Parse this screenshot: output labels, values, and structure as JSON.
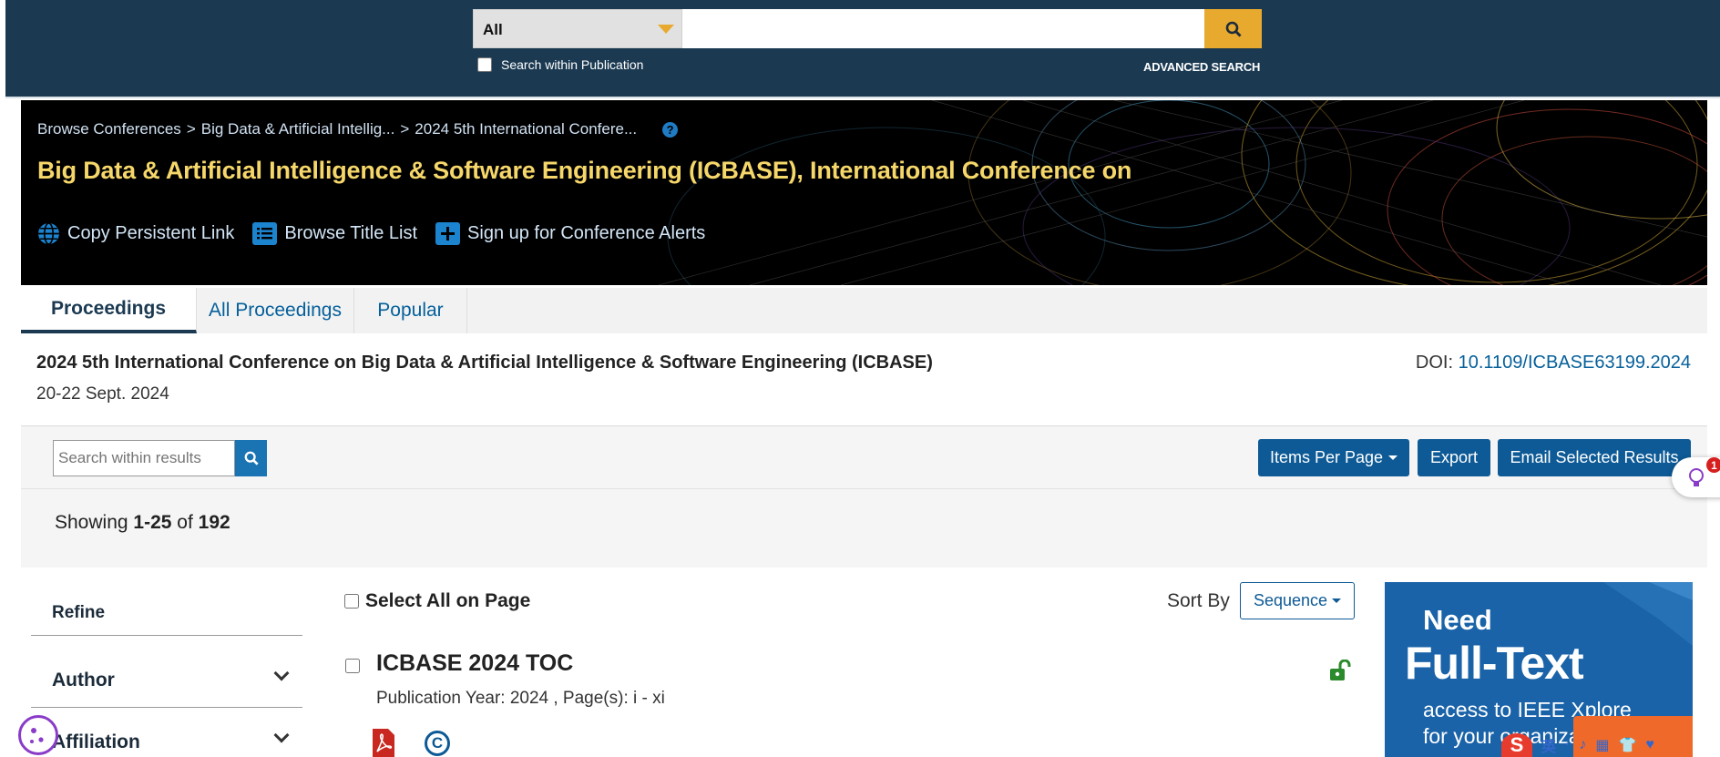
{
  "search": {
    "scope": "All",
    "query": "",
    "within_label": "Search within Publication",
    "advanced_label": "ADVANCED SEARCH"
  },
  "banner": {
    "breadcrumbs": [
      "Browse Conferences",
      "Big Data & Artificial Intellig...",
      "2024 5th International Confere..."
    ],
    "separator": ">",
    "help_glyph": "?",
    "title": "Big Data & Artificial Intelligence & Software Engineering (ICBASE), International Conference on",
    "actions": {
      "copy": "Copy Persistent Link",
      "browse": "Browse Title List",
      "alerts": "Sign up for Conference Alerts"
    }
  },
  "tabs": [
    "Proceedings",
    "All Proceedings",
    "Popular"
  ],
  "conference": {
    "full_title": "2024 5th International Conference on Big Data & Artificial Intelligence & Software Engineering (ICBASE)",
    "dates": "20-22 Sept. 2024",
    "doi_label": "DOI:",
    "doi": "10.1109/ICBASE63199.2024"
  },
  "results_toolbar": {
    "search_placeholder": "Search within results",
    "items_per_page": "Items Per Page",
    "export": "Export",
    "email": "Email Selected Results",
    "notification_count": "1"
  },
  "showing": {
    "prefix": "Showing",
    "range": "1-25",
    "of": "of",
    "total": "192"
  },
  "refine": {
    "title": "Refine",
    "facets": [
      "Author",
      "Affiliation"
    ]
  },
  "list": {
    "select_all": "Select All on Page",
    "sort_label": "Sort By",
    "sort_value": "Sequence",
    "items": [
      {
        "title": "ICBASE 2024 TOC",
        "meta": "Publication Year: 2024 , Page(s): i  -  xi",
        "copyright_glyph": "C"
      }
    ]
  },
  "ad": {
    "need": "Need",
    "full": "Full-Text",
    "line1": "access to IEEE Xplore",
    "line2": "for your organization?"
  },
  "ime": {
    "logo": "S",
    "items": [
      "英",
      "·",
      "♪",
      "▦",
      "👕",
      "♥"
    ]
  },
  "colors": {
    "header": "#1b3a52",
    "accent": "#e8a92f",
    "link": "#06609b",
    "button": "#0d5a96",
    "title_yellow": "#f6d76a"
  }
}
